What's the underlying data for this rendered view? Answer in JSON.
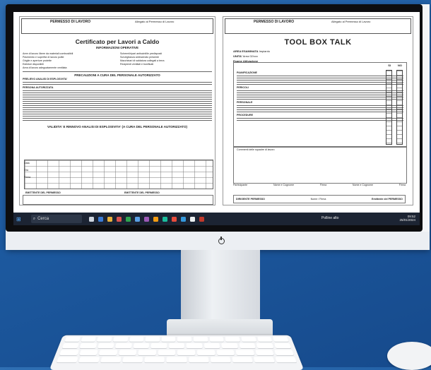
{
  "left_document": {
    "header_title": "PERMESSO DI LAVORO",
    "header_right": "Allegato al Permesso di Lavoro",
    "title": "Certificato per Lavori a Caldo",
    "section_1": "INFORMAZIONI OPERATIVE",
    "section_2": "PRECAUZIONI A CURA DEL PERSONALE AUTORIZZATO",
    "section_3": "VALIDITA' E RINNOVO ANALISI DI ESPLOSIVITA' (A CURA DEL PERSONALE AUTORIZZATO)",
    "rows": [
      "Aree di lavoro libere da materiali combustibili",
      "Pavimento e superfici di lavoro pulite",
      "Griglie e aperture protette",
      "Estintori disponibili",
      "Area di lavoro adeguatamente ventilata"
    ],
    "rows_right": [
      "Schermi/ripari antiscintille predisposti",
      "Sorveglianza antincendio presente",
      "Macchinari di saldatura collegati a terra",
      "Recipienti ventilati e bonificati"
    ],
    "analysis_label": "PRELIEVO ANALISI DI ESPLOSIVITA'",
    "personnel_label": "PERSONA AUTORIZZATA",
    "footer_left": "EMITTENTE DEL PERMESSO",
    "footer_right": "EMITTENTE DEL PERMESSO",
    "data_label": "Data",
    "ora_label": "Ora",
    "firma_label": "Firma"
  },
  "right_document": {
    "header_title": "PERMESSO DI LAVORO",
    "header_right": "Allegato al Permesso di Lavoro",
    "title": "TOOL BOX TALK",
    "area_label": "AREA ESAMINATA",
    "area_value": "Impianto",
    "unita_label": "UNITA'",
    "unita_value": "Area 02/xxx",
    "notes_label": "Esame Attivazione",
    "col_si": "SI",
    "col_no": "NO",
    "sections": [
      "PIANIFICAZIONE",
      "PERICOLI",
      "PERSONALE",
      "PROCEDURE"
    ],
    "commenti": "Commenti delle squadre di lavoro",
    "signature_cols": [
      "Partecipante",
      "Nome e Cognome",
      "Firma",
      "Nome e Cognome",
      "Firma"
    ],
    "footer_left": "DIRIGENTE PERMESSO",
    "footer_mid": "Nome / Firma",
    "footer_right": "Emittente del PERMESSO"
  },
  "taskbar": {
    "search_placeholder": "Cerca",
    "weather": "Polline alto",
    "time": "09:52",
    "date": "25/01/2024"
  }
}
